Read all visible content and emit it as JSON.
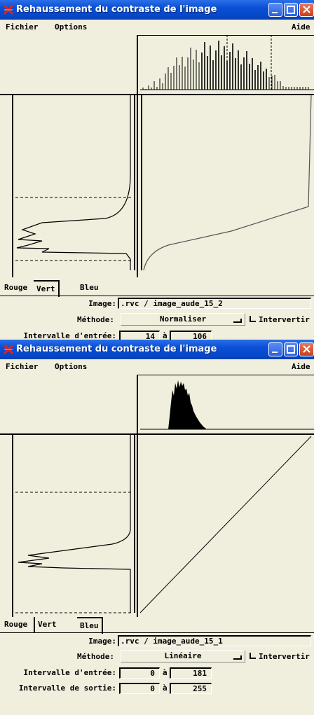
{
  "windows": [
    {
      "title": "Rehaussement du contraste de l'image",
      "menu": {
        "file": "Fichier",
        "options": "Options",
        "help": "Aide"
      },
      "tabs": [
        "Rouge",
        "Vert",
        "Bleu"
      ],
      "selected_tab": "Vert",
      "image_label": "Image:",
      "image_value": ".rvc / image_aude_15_2",
      "method_label": "Méthode:",
      "method_value": "Normaliser",
      "invert_label": "Intervertir",
      "input_range_label": "Intervalle d'entrée:",
      "input_min": "14",
      "range_sep": "à",
      "input_max": "106",
      "histogram": "spiky histogram (stretched)",
      "curve": "normalize curve"
    },
    {
      "title": "Rehaussement du contraste de l'image",
      "menu": {
        "file": "Fichier",
        "options": "Options",
        "help": "Aide"
      },
      "tabs": [
        "Rouge",
        "Vert",
        "Bleu"
      ],
      "selected_tab": "Bleu",
      "image_label": "Image:",
      "image_value": ".rvc / image_aude_15_1",
      "method_label": "Méthode:",
      "method_value": "Linéaire",
      "invert_label": "Intervertir",
      "input_range_label": "Intervalle d'entrée:",
      "input_min": "0",
      "range_sep": "à",
      "input_max": "181",
      "output_range_label": "Intervalle de sortie:",
      "output_min": "0",
      "output_max": "255",
      "histogram": "compact filled histogram",
      "curve": "linear diagonal"
    }
  ]
}
